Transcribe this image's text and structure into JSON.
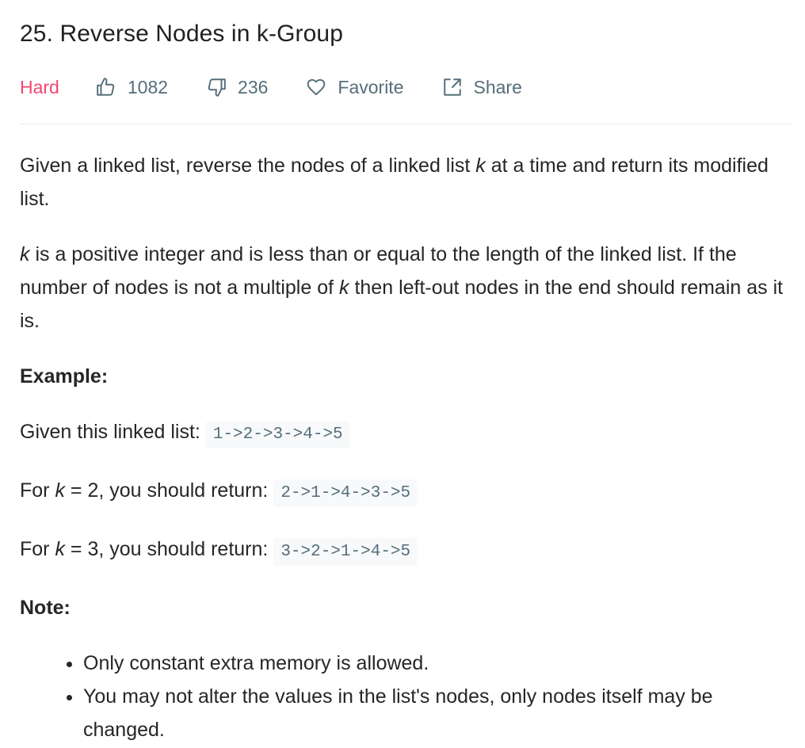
{
  "problem": {
    "title": "25. Reverse Nodes in k-Group",
    "difficulty": "Hard",
    "difficulty_color": "#ef4770",
    "likes": "1082",
    "dislikes": "236",
    "favorite_label": "Favorite",
    "share_label": "Share"
  },
  "icons": {
    "like": "thumbs-up-icon",
    "dislike": "thumbs-down-icon",
    "favorite": "heart-icon",
    "share": "share-icon"
  },
  "description": {
    "p1_part1": "Given a linked list, reverse the nodes of a linked list ",
    "p1_k": "k",
    "p1_part2": " at a time and return its modified list.",
    "p2_k1": "k",
    "p2_part1": " is a positive integer and is less than or equal to the length of the linked list. If the number of nodes is not a multiple of ",
    "p2_k2": "k",
    "p2_part2": " then left-out nodes in the end should remain as it is."
  },
  "example": {
    "heading": "Example:",
    "given_label": "Given this linked list: ",
    "given_list": "1->2->3->4->5",
    "k2_prefix": "For ",
    "k2_k": "k",
    "k2_suffix": " = 2, you should return: ",
    "k2_result": "2->1->4->3->5",
    "k3_prefix": "For ",
    "k3_k": "k",
    "k3_suffix": " = 3, you should return: ",
    "k3_result": "3->2->1->4->5"
  },
  "note": {
    "heading": "Note:",
    "items": [
      "Only constant extra memory is allowed.",
      "You may not alter the values in the list's nodes, only nodes itself may be changed."
    ]
  }
}
